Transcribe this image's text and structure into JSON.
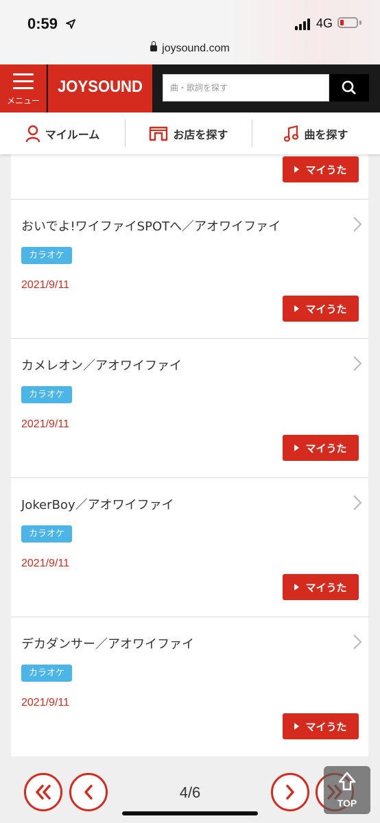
{
  "status_bar": {
    "time": "0:59",
    "network": "4G",
    "url": "joysound.com"
  },
  "header": {
    "menu_label": "メニュー",
    "logo": "JOYSOUND",
    "search_placeholder": "曲・歌詞を探す"
  },
  "subnav": {
    "my_room": "マイルーム",
    "find_store": "お店を探す",
    "find_song": "曲を探す"
  },
  "list": {
    "myuta_label": "マイうた",
    "items": [
      {
        "title": "おいでよ!ワイファイSPOTへ／アオワイファイ",
        "badge": "カラオケ",
        "date": "2021/9/11"
      },
      {
        "title": "カメレオン／アオワイファイ",
        "badge": "カラオケ",
        "date": "2021/9/11"
      },
      {
        "title": "JokerBoy／アオワイファイ",
        "badge": "カラオケ",
        "date": "2021/9/11"
      },
      {
        "title": "デカダンサー／アオワイファイ",
        "badge": "カラオケ",
        "date": "2021/9/11"
      }
    ]
  },
  "pager": {
    "indicator": "4/6",
    "top_label": "TOP"
  },
  "colors": {
    "brand_red": "#d52b1e",
    "badge_blue": "#4ab5e6",
    "header_dark": "#1a1a1a"
  }
}
